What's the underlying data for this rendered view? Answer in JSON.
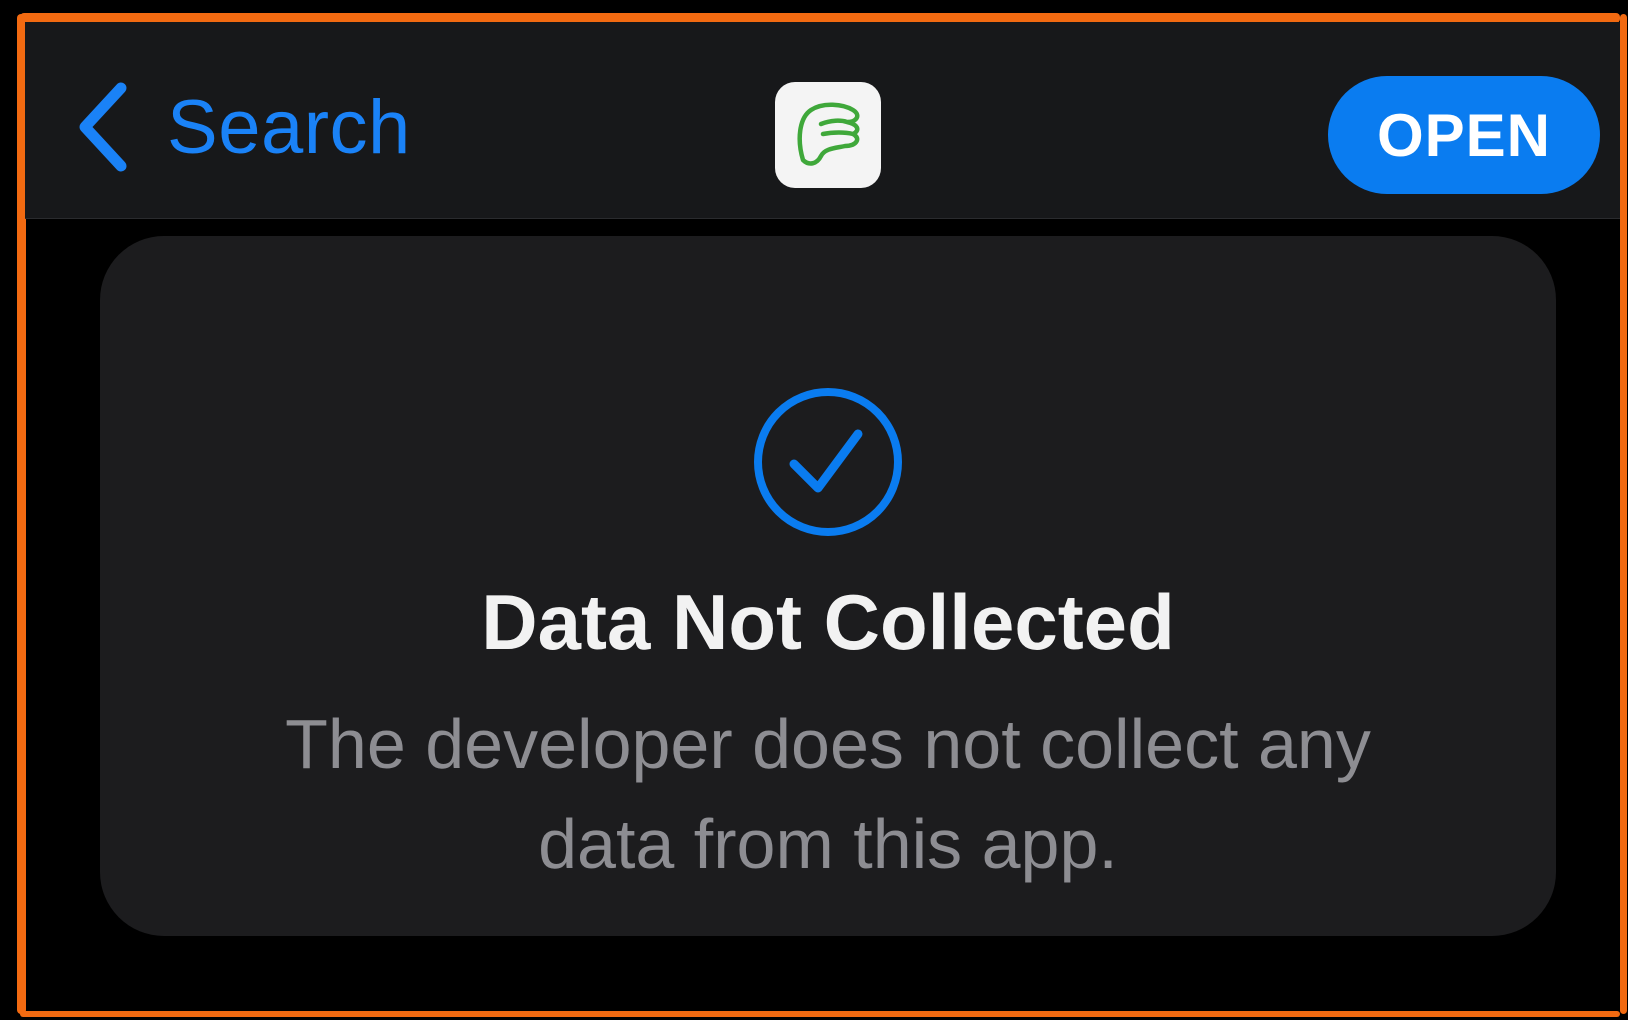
{
  "navbar": {
    "back_label": "Search",
    "back_icon": "chevron-left-icon",
    "app_icon": "app-logo-icon",
    "open_label": "OPEN"
  },
  "privacy_card": {
    "icon": "checkmark-circle-icon",
    "title": "Data Not Collected",
    "description": "The developer does not collect any data from this app."
  },
  "colors": {
    "accent": "#0a7cf0",
    "link": "#1a82f7",
    "navbar_bg": "#17181a",
    "card_bg": "#1c1c1e",
    "title_text": "#f2f2f2",
    "secondary_text": "#8d8d92",
    "frame_outline": "#f26a11",
    "app_logo_green": "#3fa83a"
  }
}
